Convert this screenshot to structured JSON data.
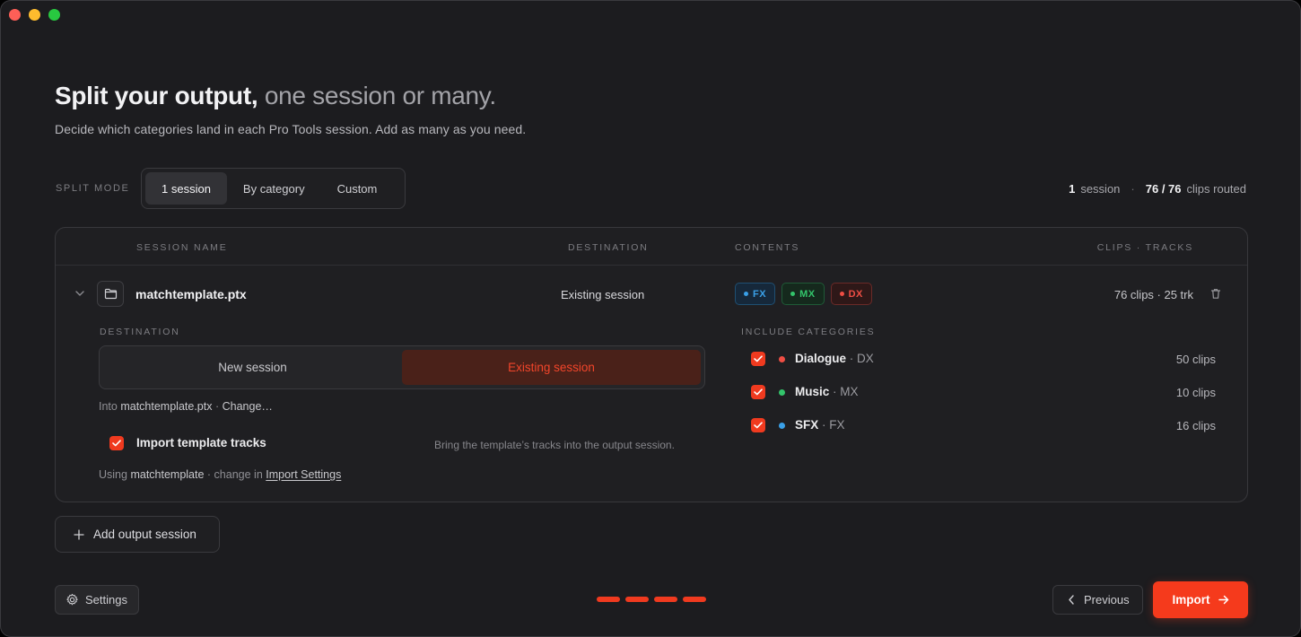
{
  "window": {
    "traffic_lights": [
      "close",
      "minimize",
      "zoom"
    ],
    "colors": {
      "background": "#1c1c1f",
      "accent": "#f03a1f"
    }
  },
  "header": {
    "title_strong": "Split your output,",
    "title_soft": "one session or many.",
    "subtitle": "Decide which categories land in each Pro Tools session. Add as many as you need."
  },
  "split_mode": {
    "label": "SPLIT MODE",
    "options": [
      "1 session",
      "By category",
      "Custom"
    ],
    "selected": "1 session"
  },
  "summary": {
    "session_count": "1",
    "session_label": "session",
    "separator": "·",
    "clips_routed": "76 / 76",
    "clips_label": "clips routed"
  },
  "table": {
    "headers": {
      "session_name": "SESSION NAME",
      "destination": "DESTINATION",
      "contents": "CONTENTS",
      "clips_tracks": "CLIPS · TRACKS"
    },
    "row": {
      "name": "matchtemplate.ptx",
      "destination": "Existing session",
      "chips": [
        {
          "label": "FX",
          "color": "#3aa0e8"
        },
        {
          "label": "MX",
          "color": "#33c46b"
        },
        {
          "label": "DX",
          "color": "#ef4e44"
        }
      ],
      "clips_tracks": "76 clips · 25 trk",
      "icons": {
        "expand": "chevron-down-icon",
        "folder": "folder-icon",
        "delete": "trash-icon"
      }
    }
  },
  "detail": {
    "destination_label": "DESTINATION",
    "destination_options": [
      "New session",
      "Existing session"
    ],
    "destination_selected": "Existing session",
    "into_prefix": "Into",
    "into_file": "matchtemplate.ptx",
    "into_sep": "·",
    "change_link": "Change…",
    "import_tracks": {
      "label": "Import template tracks",
      "checked": true,
      "hint": "Bring the template’s tracks into the output session."
    },
    "using_prefix": "Using",
    "using_template": "matchtemplate",
    "using_middle": "· change in",
    "using_link": "Import Settings",
    "categories_label": "INCLUDE CATEGORIES",
    "categories": [
      {
        "name": "Dialogue",
        "code": "· DX",
        "count": "50 clips",
        "color": "#ef4e44",
        "checked": true
      },
      {
        "name": "Music",
        "code": "· MX",
        "count": "10 clips",
        "color": "#33c46b",
        "checked": true
      },
      {
        "name": "SFX",
        "code": "· FX",
        "count": "16 clips",
        "color": "#3aa0e8",
        "checked": true
      }
    ]
  },
  "add_session": {
    "label": "Add output session",
    "icon": "plus-icon"
  },
  "footer": {
    "settings_label": "Settings",
    "settings_icon": "gear-icon",
    "steps_total": 4,
    "steps_completed": 4,
    "previous_label": "Previous",
    "import_label": "Import"
  }
}
